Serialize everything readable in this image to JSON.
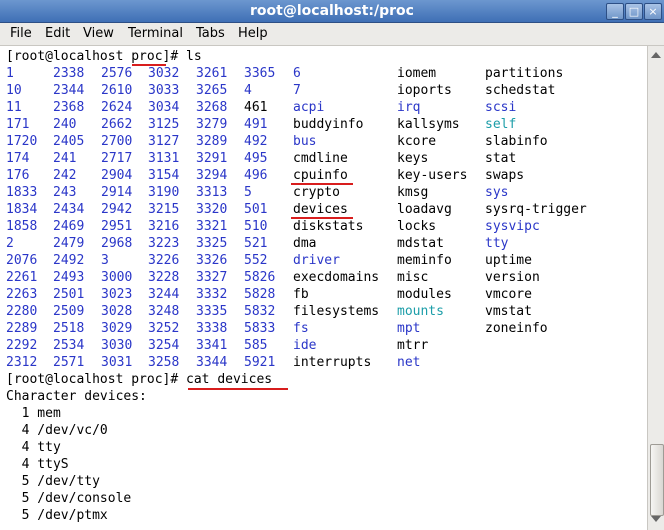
{
  "window": {
    "title": "root@localhost:/proc"
  },
  "menu": [
    "File",
    "Edit",
    "View",
    "Terminal",
    "Tabs",
    "Help"
  ],
  "prompt_ls": {
    "prefix": "[root@localhost ",
    "dir": "proc",
    "suffix": "]# ls"
  },
  "ls_rows": [
    [
      "1",
      "2338",
      "2576",
      "3032",
      "3261",
      "3365",
      "6",
      "iomem",
      "partitions"
    ],
    [
      "10",
      "2344",
      "2610",
      "3033",
      "3265",
      "4",
      "7",
      "ioports",
      "schedstat"
    ],
    [
      "11",
      "2368",
      "2624",
      "3034",
      "3268",
      "461",
      "acpi",
      "irq",
      "scsi"
    ],
    [
      "171",
      "240",
      "2662",
      "3125",
      "3279",
      "491",
      "buddyinfo",
      "kallsyms",
      "self"
    ],
    [
      "1720",
      "2405",
      "2700",
      "3127",
      "3289",
      "492",
      "bus",
      "kcore",
      "slabinfo"
    ],
    [
      "174",
      "241",
      "2717",
      "3131",
      "3291",
      "495",
      "cmdline",
      "keys",
      "stat"
    ],
    [
      "176",
      "242",
      "2904",
      "3154",
      "3294",
      "496",
      "cpuinfo",
      "key-users",
      "swaps"
    ],
    [
      "1833",
      "243",
      "2914",
      "3190",
      "3313",
      "5",
      "crypto",
      "kmsg",
      "sys"
    ],
    [
      "1834",
      "2434",
      "2942",
      "3215",
      "3320",
      "501",
      "devices",
      "loadavg",
      "sysrq-trigger"
    ],
    [
      "1858",
      "2469",
      "2951",
      "3216",
      "3321",
      "510",
      "diskstats",
      "locks",
      "sysvipc"
    ],
    [
      "2",
      "2479",
      "2968",
      "3223",
      "3325",
      "521",
      "dma",
      "mdstat",
      "tty"
    ],
    [
      "2076",
      "2492",
      "3",
      "3226",
      "3326",
      "552",
      "driver",
      "meminfo",
      "uptime"
    ],
    [
      "2261",
      "2493",
      "3000",
      "3228",
      "3327",
      "5826",
      "execdomains",
      "misc",
      "version"
    ],
    [
      "2263",
      "2501",
      "3023",
      "3244",
      "3332",
      "5828",
      "fb",
      "modules",
      "vmcore"
    ],
    [
      "2280",
      "2509",
      "3028",
      "3248",
      "3335",
      "5832",
      "filesystems",
      "mounts",
      "vmstat"
    ],
    [
      "2289",
      "2518",
      "3029",
      "3252",
      "3338",
      "5833",
      "fs",
      "mpt",
      "zoneinfo"
    ],
    [
      "2292",
      "2534",
      "3030",
      "3254",
      "3341",
      "585",
      "ide",
      "mtrr",
      ""
    ],
    [
      "2312",
      "2571",
      "3031",
      "3258",
      "3344",
      "5921",
      "interrupts",
      "net",
      ""
    ]
  ],
  "ls_styles": [
    [
      "d",
      "d",
      "d",
      "d",
      "d",
      "d",
      "d",
      "n",
      "n"
    ],
    [
      "d",
      "d",
      "d",
      "d",
      "d",
      "d",
      "d",
      "n",
      "n"
    ],
    [
      "d",
      "d",
      "d",
      "d",
      "d",
      "n",
      "d",
      "d",
      "d"
    ],
    [
      "d",
      "d",
      "d",
      "d",
      "d",
      "d",
      "n",
      "n",
      "c"
    ],
    [
      "d",
      "d",
      "d",
      "d",
      "d",
      "d",
      "d",
      "n",
      "n"
    ],
    [
      "d",
      "d",
      "d",
      "d",
      "d",
      "d",
      "n",
      "n",
      "n"
    ],
    [
      "d",
      "d",
      "d",
      "d",
      "d",
      "d",
      "n",
      "n",
      "n"
    ],
    [
      "d",
      "d",
      "d",
      "d",
      "d",
      "d",
      "n",
      "n",
      "d"
    ],
    [
      "d",
      "d",
      "d",
      "d",
      "d",
      "d",
      "n",
      "n",
      "n"
    ],
    [
      "d",
      "d",
      "d",
      "d",
      "d",
      "d",
      "n",
      "n",
      "d"
    ],
    [
      "d",
      "d",
      "d",
      "d",
      "d",
      "d",
      "n",
      "n",
      "d"
    ],
    [
      "d",
      "d",
      "d",
      "d",
      "d",
      "d",
      "d",
      "n",
      "n"
    ],
    [
      "d",
      "d",
      "d",
      "d",
      "d",
      "d",
      "n",
      "n",
      "n"
    ],
    [
      "d",
      "d",
      "d",
      "d",
      "d",
      "d",
      "n",
      "n",
      "n"
    ],
    [
      "d",
      "d",
      "d",
      "d",
      "d",
      "d",
      "n",
      "c",
      "n"
    ],
    [
      "d",
      "d",
      "d",
      "d",
      "d",
      "d",
      "d",
      "d",
      "n"
    ],
    [
      "d",
      "d",
      "d",
      "d",
      "d",
      "d",
      "d",
      "n",
      "n"
    ],
    [
      "d",
      "d",
      "d",
      "d",
      "d",
      "d",
      "n",
      "d",
      "n"
    ]
  ],
  "prompt_cat": {
    "prefix": "[root@localhost proc]# ",
    "command": "cat devices"
  },
  "output": [
    "Character devices:",
    "  1 mem",
    "  4 /dev/vc/0",
    "  4 tty",
    "  4 ttyS",
    "  5 /dev/tty",
    "  5 /dev/console",
    "  5 /dev/ptmx"
  ],
  "colors": {
    "directory": "#2a36c8",
    "symlink": "#1b9da8",
    "annotation": "#d81d1d"
  }
}
